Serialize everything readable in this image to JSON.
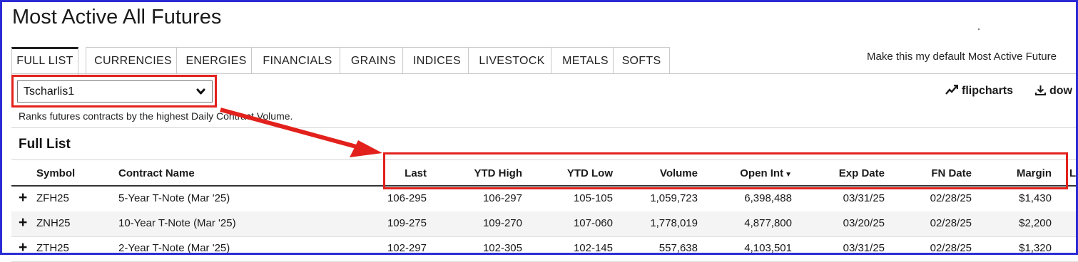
{
  "page": {
    "title": "Most Active All Futures",
    "default_link": "Make this my default Most Active Future"
  },
  "tabs": [
    "FULL LIST",
    "CURRENCIES",
    "ENERGIES",
    "FINANCIALS",
    "GRAINS",
    "INDICES",
    "LIVESTOCK",
    "METALS",
    "SOFTS"
  ],
  "active_tab": 0,
  "select": {
    "value": "Tscharlis1"
  },
  "actions": {
    "flipcharts": "flipcharts",
    "download": "dow"
  },
  "description": "Ranks futures contracts by the highest Daily Contract Volume.",
  "section_title": "Full List",
  "table": {
    "columns": [
      "Symbol",
      "Contract Name",
      "Last",
      "YTD High",
      "YTD Low",
      "Volume",
      "Open Int",
      "Exp Date",
      "FN Date",
      "Margin",
      "L"
    ],
    "rows": [
      [
        "ZFH25",
        "5-Year T-Note (Mar '25)",
        "106-295",
        "106-297",
        "105-105",
        "1,059,723",
        "6,398,488",
        "03/31/25",
        "02/28/25",
        "$1,430"
      ],
      [
        "ZNH25",
        "10-Year T-Note (Mar '25)",
        "109-275",
        "109-270",
        "107-060",
        "1,778,019",
        "4,877,800",
        "03/20/25",
        "02/28/25",
        "$2,200"
      ],
      [
        "ZTH25",
        "2-Year T-Note (Mar '25)",
        "102-297",
        "102-305",
        "102-145",
        "557,638",
        "4,103,501",
        "03/31/25",
        "02/28/25",
        "$1,320"
      ]
    ]
  },
  "colors": {
    "highlight": "#e3211c",
    "frame": "#2b2bd6"
  }
}
